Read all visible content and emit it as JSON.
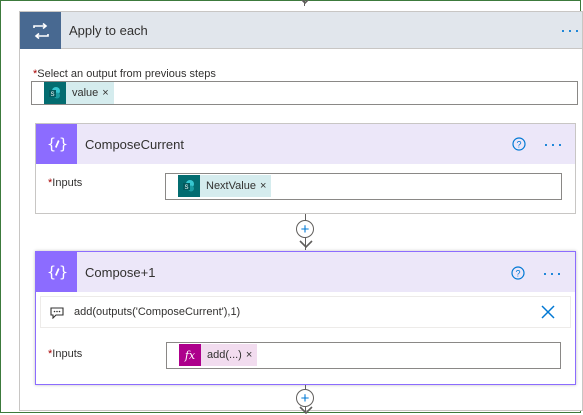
{
  "colors": {
    "loop_header": "#e1e6ec",
    "loop_icon": "#486991",
    "compose_header": "#ece7f9",
    "compose_icon": "#8c6cff",
    "sharepoint_token": "#036c70",
    "expression_token": "#ad008c",
    "accent": "#0078d4",
    "required": "#a80000"
  },
  "loop": {
    "title": "Apply to each",
    "more_label": "···",
    "select_label": "Select an output from previous steps",
    "token": {
      "label": "value",
      "remove": "×",
      "icon": "sharepoint-icon"
    }
  },
  "compose_current": {
    "title": "ComposeCurrent",
    "more_label": "···",
    "inputs_label": "Inputs",
    "token": {
      "label": "NextValue",
      "remove": "×",
      "icon": "sharepoint-icon"
    }
  },
  "compose_plus": {
    "title": "Compose+1",
    "more_label": "···",
    "expression": "add(outputs('ComposeCurrent'),1)",
    "inputs_label": "Inputs",
    "token": {
      "label": "add(...)",
      "remove": "×",
      "icon": "fx-icon",
      "icon_text": "fx"
    }
  },
  "required_mark": "*",
  "add_step_symbol": "+"
}
